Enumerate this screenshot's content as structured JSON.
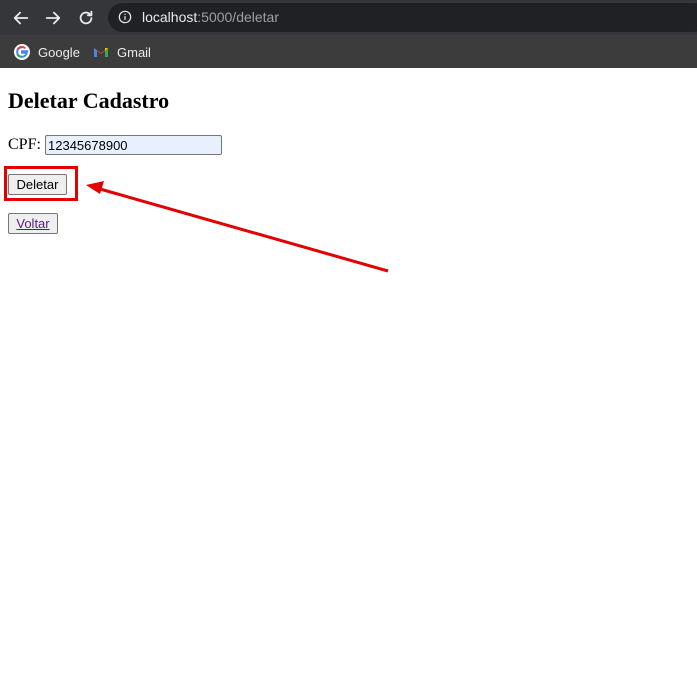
{
  "browser": {
    "url_host": "localhost",
    "url_path": ":5000/deletar",
    "bookmarks": [
      {
        "label": "Google",
        "icon": "google-icon"
      },
      {
        "label": "Gmail",
        "icon": "gmail-icon"
      }
    ]
  },
  "page": {
    "title": "Deletar Cadastro",
    "cpf_label": "CPF:",
    "cpf_value": "12345678900",
    "delete_label": "Deletar",
    "back_label": "Voltar"
  },
  "annotation": {
    "color": "#e30000"
  }
}
